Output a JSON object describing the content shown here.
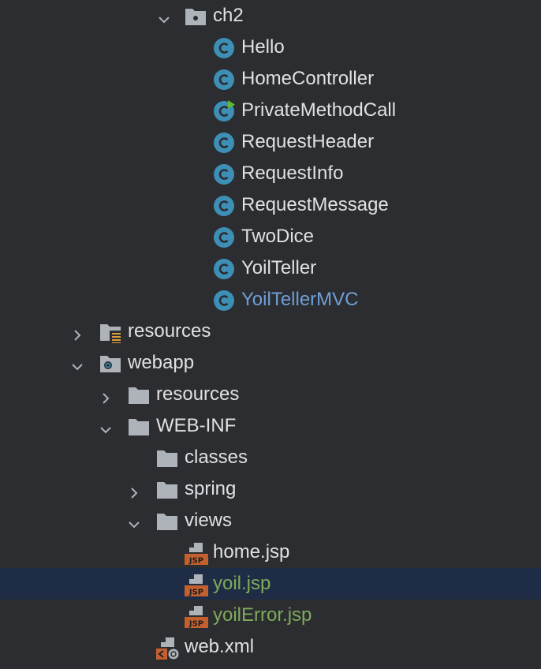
{
  "tree": {
    "rows": [
      {
        "label": "ch2",
        "type": "package",
        "expand": "expanded"
      },
      {
        "label": "Hello",
        "type": "class"
      },
      {
        "label": "HomeController",
        "type": "class"
      },
      {
        "label": "PrivateMethodCall",
        "type": "class-runnable"
      },
      {
        "label": "RequestHeader",
        "type": "class"
      },
      {
        "label": "RequestInfo",
        "type": "class"
      },
      {
        "label": "RequestMessage",
        "type": "class"
      },
      {
        "label": "TwoDice",
        "type": "class"
      },
      {
        "label": "YoilTeller",
        "type": "class"
      },
      {
        "label": "YoilTellerMVC",
        "type": "class",
        "status": "modified"
      },
      {
        "label": "resources",
        "type": "resources-root-folder",
        "expand": "collapsed"
      },
      {
        "label": "webapp",
        "type": "web-root-folder",
        "expand": "expanded"
      },
      {
        "label": "resources",
        "type": "folder",
        "expand": "collapsed"
      },
      {
        "label": "WEB-INF",
        "type": "folder",
        "expand": "expanded"
      },
      {
        "label": "classes",
        "type": "folder"
      },
      {
        "label": "spring",
        "type": "folder",
        "expand": "collapsed"
      },
      {
        "label": "views",
        "type": "folder",
        "expand": "expanded"
      },
      {
        "label": "home.jsp",
        "type": "jsp-file"
      },
      {
        "label": "yoil.jsp",
        "type": "jsp-file",
        "status": "added",
        "selected": true
      },
      {
        "label": "yoilError.jsp",
        "type": "jsp-file",
        "status": "added"
      },
      {
        "label": "web.xml",
        "type": "xml-file"
      }
    ]
  },
  "colors": {
    "background": "#2b2d30",
    "selection": "#1e2d45",
    "text": "#dfe1e5",
    "modified_text": "#6f9fd8",
    "added_text": "#7faa5a",
    "class_icon": "#3d8fb6",
    "folder_icon": "#aeb3ba",
    "jsp_badge": "#c3602e"
  }
}
